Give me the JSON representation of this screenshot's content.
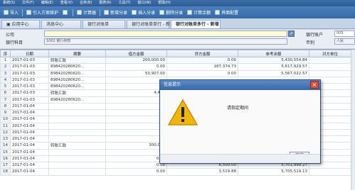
{
  "menubar": {
    "items": [
      "系统(S)",
      "文件(F)",
      "编辑(E)",
      "查看(V)",
      "业务(B)",
      "报表(R)",
      "工具(T)",
      "窗口(W)",
      "帮助(H)"
    ]
  },
  "toolbar": {
    "buttons": [
      "导入",
      "引入方案维护",
      "",
      "计算器",
      "新增分录",
      "插入分录",
      "删除分录",
      "计算余额",
      "界面配置"
    ]
  },
  "tabs": [
    "应用中心",
    "消息中心",
    "银行对账单",
    "银行对账单单行 - 新增",
    "银行对账单多行 - 新增"
  ],
  "form": {
    "company_label": "公司",
    "bank_account_label": "银行账户",
    "bank_account_value": "005",
    "bank_subject_label": "银行科目",
    "bank_subject_value": "1002 银行存款",
    "currency_label": "币别",
    "currency_value": "人民"
  },
  "table": {
    "headers": [
      "序",
      "日期",
      "摘要",
      "借方金额",
      "贷方金额",
      "参考余额",
      "对方单位"
    ],
    "rows": [
      [
        "1",
        "2017-01-03",
        "转账汇款",
        "200,000.00",
        "0.00",
        "5,430,554.84",
        ""
      ],
      [
        "2",
        "2017-01-03",
        "898420280620...",
        "0.00",
        "187,374.73",
        "5,617,929.57",
        ""
      ],
      [
        "3",
        "2017-01-03",
        "898420280620...",
        "50,907.00",
        "0.00",
        "5,567,022.57",
        ""
      ],
      [
        "4",
        "2017-01-03",
        "898420280620...",
        "",
        "",
        "",
        ""
      ],
      [
        "5",
        "2017-01-03",
        "898420280620...",
        "",
        "",
        "",
        ""
      ],
      [
        "6",
        "2017-01-03",
        "转账汇款",
        "4,450",
        "",
        "",
        ""
      ],
      [
        "7",
        "2017-01-03",
        "898420280620...",
        "",
        "",
        "",
        ""
      ],
      [
        "8",
        "2017-01-04",
        "",
        "",
        "",
        "",
        ""
      ],
      [
        "9",
        "2017-01-04",
        "",
        "",
        "",
        "",
        ""
      ],
      [
        "10",
        "2017-01-04",
        "",
        "",
        "",
        "",
        ""
      ],
      [
        "11",
        "2017-01-04",
        "",
        "",
        "",
        "",
        ""
      ],
      [
        "12",
        "2017-01-04",
        "",
        "",
        "",
        "",
        ""
      ],
      [
        "13",
        "2017-01-04",
        "",
        "",
        "",
        "",
        ""
      ],
      [
        "14",
        "2017-01-04",
        "转账汇款",
        "300,000",
        "",
        "",
        ""
      ],
      [
        "15",
        "2017-01-04",
        "",
        "",
        "",
        "",
        ""
      ],
      [
        "16",
        "2017-01-04",
        "",
        "0.00",
        "40,100.00",
        "5,685,499.27",
        ""
      ],
      [
        "17",
        "2017-01-04",
        "",
        "0.00",
        "6,500.00",
        "5,701,999.27",
        ""
      ],
      [
        "18",
        "2017-01-04",
        "",
        "0.00",
        "3,519.88",
        "5,705,519.13",
        ""
      ]
    ]
  },
  "dialog": {
    "title": "信息提示",
    "message": "请指定期间",
    "ok_label": "确定",
    "close_glyph": "×"
  }
}
